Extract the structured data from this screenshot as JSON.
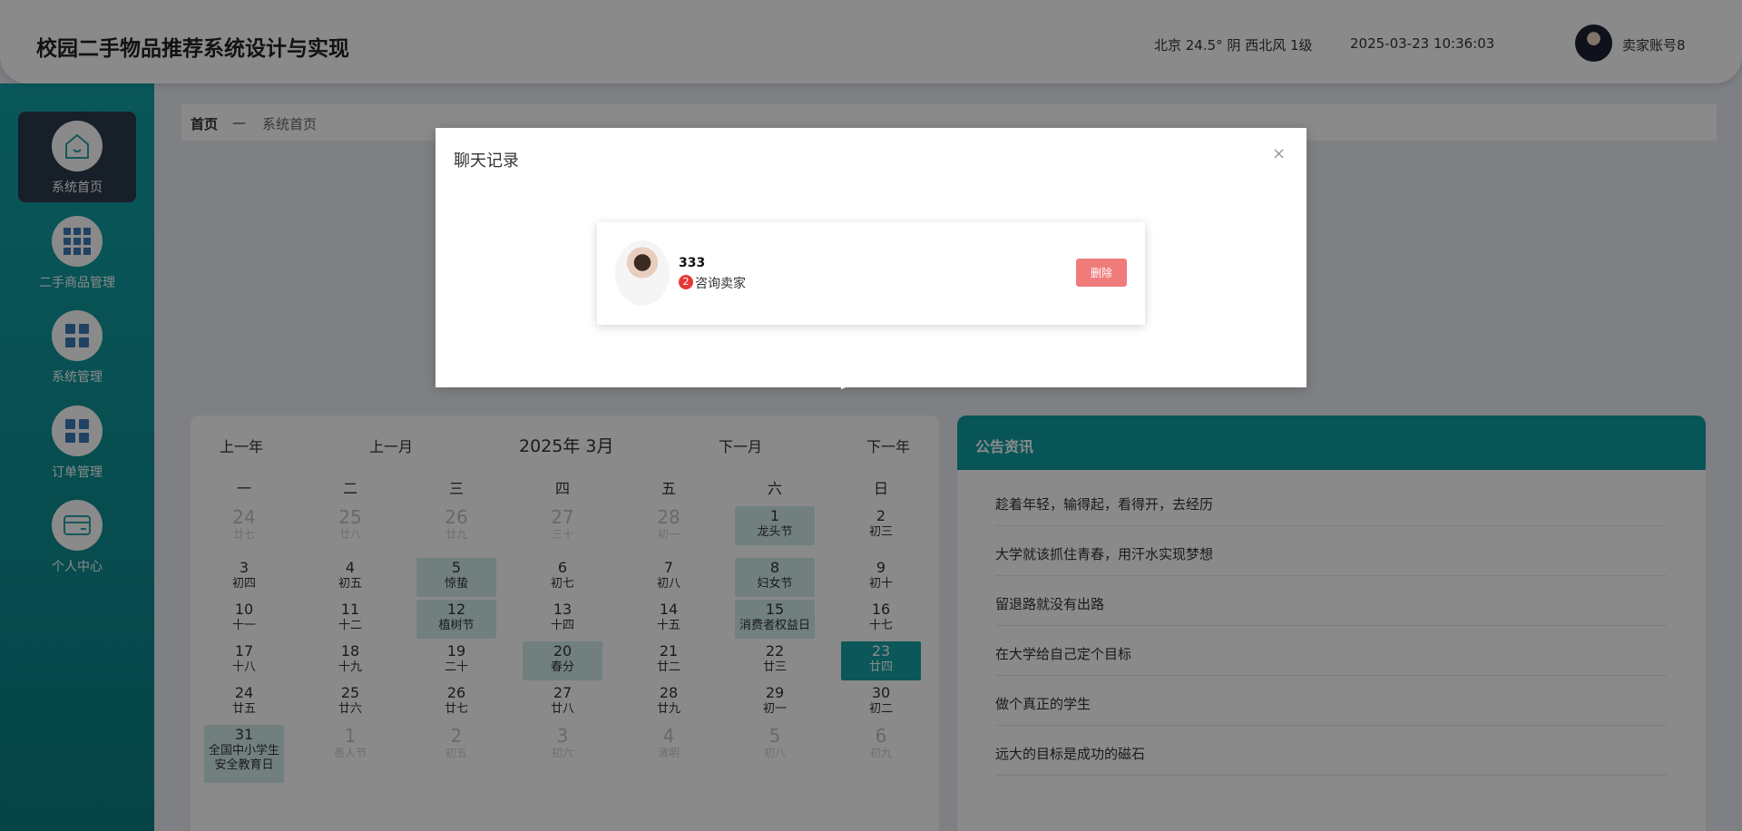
{
  "header": {
    "title": "校园二手物品推荐系统设计与实现",
    "weather": "北京  24.5°  阴  西北风  1级",
    "datetime": "2025-03-23 10:36:03",
    "username": "卖家账号8"
  },
  "sidebar": {
    "items": [
      {
        "label": "系统首页",
        "icon": "home-icon",
        "active": true
      },
      {
        "label": "二手商品管理",
        "icon": "grid-icon"
      },
      {
        "label": "系统管理",
        "icon": "apps-icon"
      },
      {
        "label": "订单管理",
        "icon": "apps-icon"
      },
      {
        "label": "个人中心",
        "icon": "card-icon"
      }
    ]
  },
  "breadcrumb": {
    "home": "首页",
    "sep": "—",
    "current": "系统首页"
  },
  "calendar": {
    "prev_year": "上一年",
    "prev_month": "上一月",
    "title": "2025年 3月",
    "next_month": "下一月",
    "next_year": "下一年",
    "weekdays": [
      "一",
      "二",
      "三",
      "四",
      "五",
      "六",
      "日"
    ],
    "weeks": [
      [
        {
          "d": "24",
          "l": "廿七",
          "o": true
        },
        {
          "d": "25",
          "l": "廿八",
          "o": true
        },
        {
          "d": "26",
          "l": "廿九",
          "o": true
        },
        {
          "d": "27",
          "l": "三十",
          "o": true
        },
        {
          "d": "28",
          "l": "初一",
          "o": true
        },
        {
          "d": "1",
          "l": "龙头节",
          "h": true
        },
        {
          "d": "2",
          "l": "初三"
        }
      ],
      [
        {
          "d": "3",
          "l": "初四"
        },
        {
          "d": "4",
          "l": "初五"
        },
        {
          "d": "5",
          "l": "惊蛰",
          "h": true
        },
        {
          "d": "6",
          "l": "初七"
        },
        {
          "d": "7",
          "l": "初八"
        },
        {
          "d": "8",
          "l": "妇女节",
          "h": true
        },
        {
          "d": "9",
          "l": "初十"
        }
      ],
      [
        {
          "d": "10",
          "l": "十一"
        },
        {
          "d": "11",
          "l": "十二"
        },
        {
          "d": "12",
          "l": "植树节",
          "h": true
        },
        {
          "d": "13",
          "l": "十四"
        },
        {
          "d": "14",
          "l": "十五"
        },
        {
          "d": "15",
          "l": "消费者权益日",
          "h": true
        },
        {
          "d": "16",
          "l": "十七"
        }
      ],
      [
        {
          "d": "17",
          "l": "十八"
        },
        {
          "d": "18",
          "l": "十九"
        },
        {
          "d": "19",
          "l": "二十"
        },
        {
          "d": "20",
          "l": "春分",
          "h": true
        },
        {
          "d": "21",
          "l": "廿二"
        },
        {
          "d": "22",
          "l": "廿三"
        },
        {
          "d": "23",
          "l": "廿四",
          "t": true
        }
      ],
      [
        {
          "d": "24",
          "l": "廿五"
        },
        {
          "d": "25",
          "l": "廿六"
        },
        {
          "d": "26",
          "l": "廿七"
        },
        {
          "d": "27",
          "l": "廿八"
        },
        {
          "d": "28",
          "l": "廿九"
        },
        {
          "d": "29",
          "l": "初一"
        },
        {
          "d": "30",
          "l": "初二"
        }
      ],
      [
        {
          "d": "31",
          "l": "全国中小学生安全教育日",
          "h": true,
          "tall": true
        },
        {
          "d": "1",
          "l": "愚人节",
          "o": true
        },
        {
          "d": "2",
          "l": "初五",
          "o": true
        },
        {
          "d": "3",
          "l": "初六",
          "o": true
        },
        {
          "d": "4",
          "l": "清明",
          "o": true
        },
        {
          "d": "5",
          "l": "初八",
          "o": true
        },
        {
          "d": "6",
          "l": "初九",
          "o": true
        }
      ]
    ]
  },
  "notice": {
    "title": "公告资讯",
    "items": [
      "趁着年轻，输得起，看得开，去经历",
      "大学就该抓住青春，用汗水实现梦想",
      "留退路就没有出路",
      "在大学给自己定个目标",
      "做个真正的学生",
      "远大的目标是成功的磁石"
    ]
  },
  "modal": {
    "title": "聊天记录",
    "close": "×",
    "chat": {
      "name": "333",
      "badge": "2",
      "message": "咨询卖家",
      "delete_label": "删除"
    }
  },
  "colors": {
    "teal": "#12a2a6",
    "notice_head": "#0f9da2",
    "highlight": "#d1eaea",
    "delete": "#f07b7b"
  }
}
